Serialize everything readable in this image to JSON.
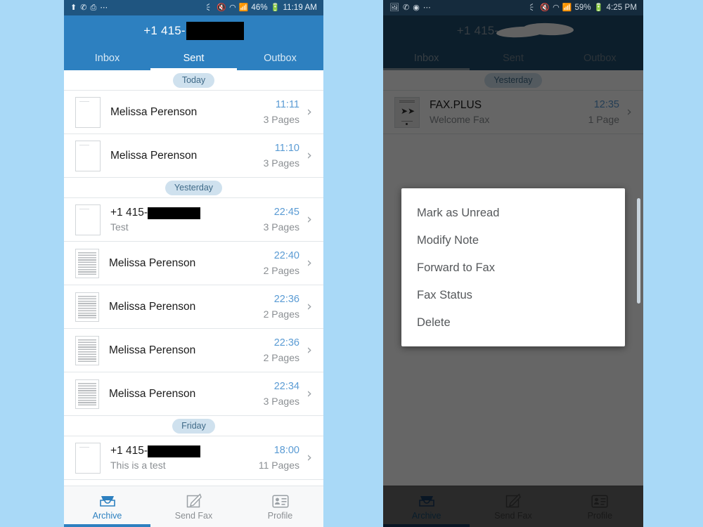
{
  "background_color": "#a9d9f7",
  "theme": {
    "header_blue": "#2d80c0",
    "statusbar_blue": "#1f5580",
    "accent_time": "#5a9bd4",
    "chip_bg": "#cfe1ee",
    "dim_overlay": "#666666"
  },
  "left_phone": {
    "statusbar": {
      "left_icons": [
        "upload-icon",
        "missed-call-icon",
        "print-icon",
        "more-icon"
      ],
      "right_icons": [
        "bluetooth-icon",
        "mute-icon",
        "wifi-icon",
        "signal-icon"
      ],
      "battery": "46%",
      "battery_icon": "battery-icon",
      "time": "11:19 AM"
    },
    "header": {
      "title_prefix": "+1 415-",
      "title_redacted": true
    },
    "tabs": [
      {
        "label": "Inbox",
        "active": false
      },
      {
        "label": "Sent",
        "active": true
      },
      {
        "label": "Outbox",
        "active": false
      }
    ],
    "groups": [
      {
        "day": "Today",
        "rows": [
          {
            "thumb": "blank-page",
            "title": "Melissa Perenson",
            "redacted": false,
            "note": "",
            "time": "11:11",
            "pages": "3 Pages"
          },
          {
            "thumb": "blank-page",
            "title": "Melissa Perenson",
            "redacted": false,
            "note": "",
            "time": "11:10",
            "pages": "3 Pages"
          }
        ]
      },
      {
        "day": "Yesterday",
        "rows": [
          {
            "thumb": "blank-page",
            "title": "+1 415-",
            "redacted": true,
            "note": "Test",
            "time": "22:45",
            "pages": "3 Pages"
          },
          {
            "thumb": "text-page",
            "title": "Melissa Perenson",
            "redacted": false,
            "note": "",
            "time": "22:40",
            "pages": "2 Pages"
          },
          {
            "thumb": "text-page",
            "title": "Melissa Perenson",
            "redacted": false,
            "note": "",
            "time": "22:36",
            "pages": "2 Pages"
          },
          {
            "thumb": "text-page",
            "title": "Melissa Perenson",
            "redacted": false,
            "note": "",
            "time": "22:36",
            "pages": "2 Pages"
          },
          {
            "thumb": "text-page",
            "title": "Melissa Perenson",
            "redacted": false,
            "note": "",
            "time": "22:34",
            "pages": "3 Pages"
          }
        ]
      },
      {
        "day": "Friday",
        "rows": [
          {
            "thumb": "blank-page",
            "title": "+1 415-",
            "redacted": true,
            "note": "This is a test",
            "time": "18:00",
            "pages": "11 Pages"
          }
        ]
      }
    ],
    "bottom_nav": [
      {
        "label": "Archive",
        "icon": "archive-inbox-icon",
        "active": true
      },
      {
        "label": "Send Fax",
        "icon": "compose-pencil-icon",
        "active": false
      },
      {
        "label": "Profile",
        "icon": "contact-card-icon",
        "active": false
      }
    ]
  },
  "right_phone": {
    "statusbar": {
      "left_icons": [
        "image-icon",
        "missed-call-icon",
        "chrome-icon",
        "more-icon"
      ],
      "right_icons": [
        "bluetooth-icon",
        "mute-icon",
        "wifi-icon",
        "signal-icon"
      ],
      "battery": "59%",
      "battery_icon": "battery-icon",
      "time": "4:25 PM"
    },
    "header": {
      "title_prefix": "+1 415-",
      "title_redacted": true
    },
    "tabs": [
      {
        "label": "Inbox",
        "active": true
      },
      {
        "label": "Sent",
        "active": false
      },
      {
        "label": "Outbox",
        "active": false
      }
    ],
    "groups": [
      {
        "day": "Yesterday",
        "rows": [
          {
            "thumb": "fax-cover-page",
            "title": "FAX.PLUS",
            "redacted": false,
            "note": "Welcome Fax",
            "time": "12:35",
            "pages": "1 Page"
          }
        ]
      }
    ],
    "context_menu": {
      "items": [
        "Mark as Unread",
        "Modify Note",
        "Forward to Fax",
        "Fax Status",
        "Delete"
      ]
    },
    "bottom_nav": [
      {
        "label": "Archive",
        "icon": "archive-inbox-icon",
        "active": true
      },
      {
        "label": "Send Fax",
        "icon": "compose-pencil-icon",
        "active": false
      },
      {
        "label": "Profile",
        "icon": "contact-card-icon",
        "active": false
      }
    ]
  }
}
